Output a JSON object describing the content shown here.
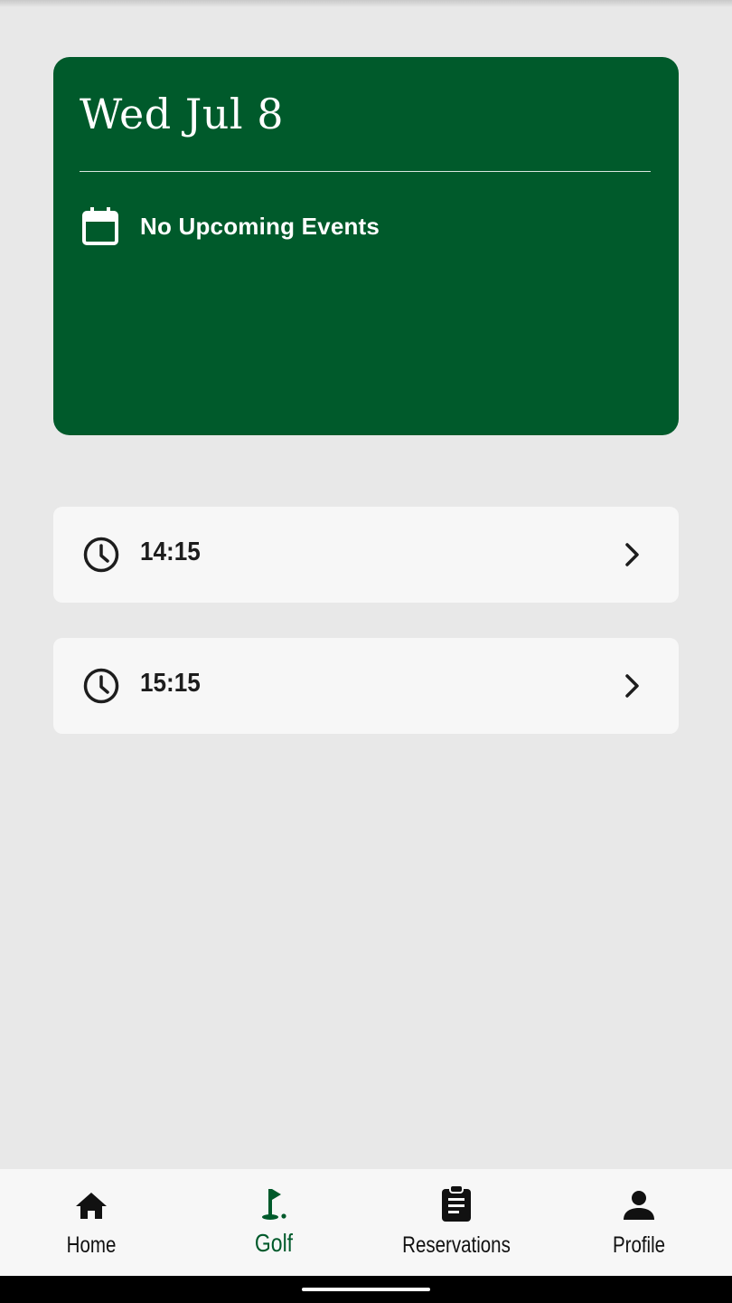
{
  "colors": {
    "brand_green": "#005a2b",
    "background": "#e8e8e8",
    "card_light": "#f7f7f7",
    "text_dark": "#1d1d1d"
  },
  "date_card": {
    "date": "Wed Jul 8",
    "events_text": "No Upcoming Events",
    "icon": "calendar-icon"
  },
  "slots": [
    {
      "time": "14:15",
      "icon": "clock-icon",
      "action_icon": "chevron-right-icon"
    },
    {
      "time": "15:15",
      "icon": "clock-icon",
      "action_icon": "chevron-right-icon"
    }
  ],
  "bottom_nav": {
    "items": [
      {
        "label": "Home",
        "icon": "home-icon",
        "active": false
      },
      {
        "label": "Golf",
        "icon": "golf-flag-icon",
        "active": true
      },
      {
        "label": "Reservations",
        "icon": "clipboard-icon",
        "active": false
      },
      {
        "label": "Profile",
        "icon": "person-icon",
        "active": false
      }
    ]
  }
}
